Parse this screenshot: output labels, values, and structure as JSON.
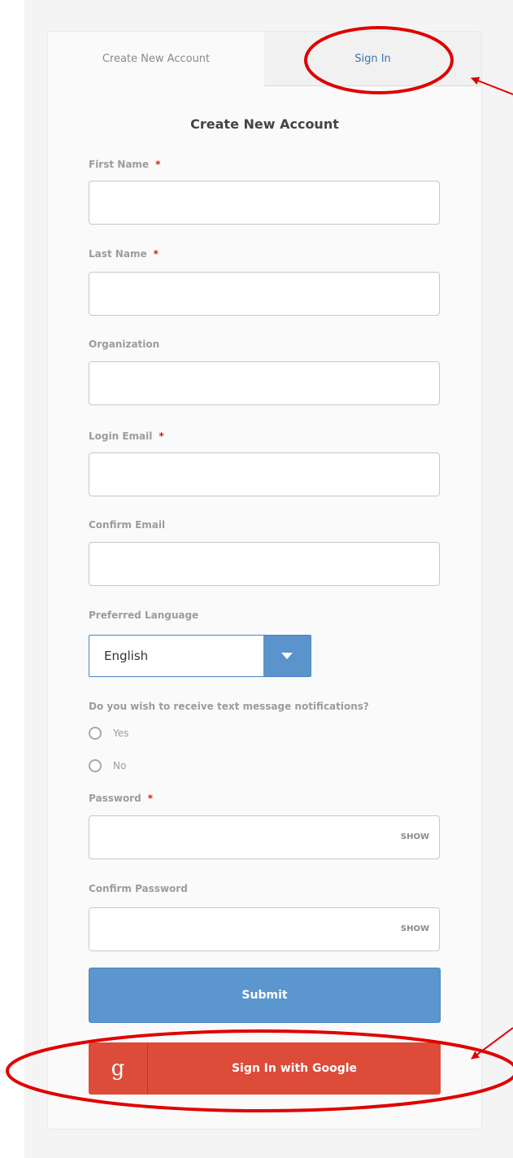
{
  "tabs": [
    {
      "label": "Create New Account",
      "active": true
    },
    {
      "label": "Sign In",
      "active": false
    }
  ],
  "form": {
    "title": "Create New Account",
    "required_marker": "*",
    "fields": {
      "first_name": {
        "label": "First Name",
        "value": ""
      },
      "last_name": {
        "label": "Last Name",
        "value": ""
      },
      "organization": {
        "label": "Organization",
        "value": ""
      },
      "login_email": {
        "label": "Login Email",
        "value": ""
      },
      "confirm_email": {
        "label": "Confirm Email",
        "value": ""
      },
      "password": {
        "label": "Password",
        "value": "",
        "toggle": "SHOW"
      },
      "confirm_password": {
        "label": "Confirm Password",
        "value": "",
        "toggle": "SHOW"
      }
    },
    "language": {
      "label": "Preferred Language",
      "selected": "English"
    },
    "sms": {
      "question": "Do you wish to receive text message notifications?",
      "options": [
        "Yes",
        "No"
      ]
    },
    "submit_label": "Submit",
    "google": {
      "icon": "g",
      "label": "Sign In with Google"
    }
  },
  "colors": {
    "accent": "#5b96ce",
    "google": "#dd4b39",
    "required": "#d21f1f",
    "annotation": "#e00000"
  }
}
